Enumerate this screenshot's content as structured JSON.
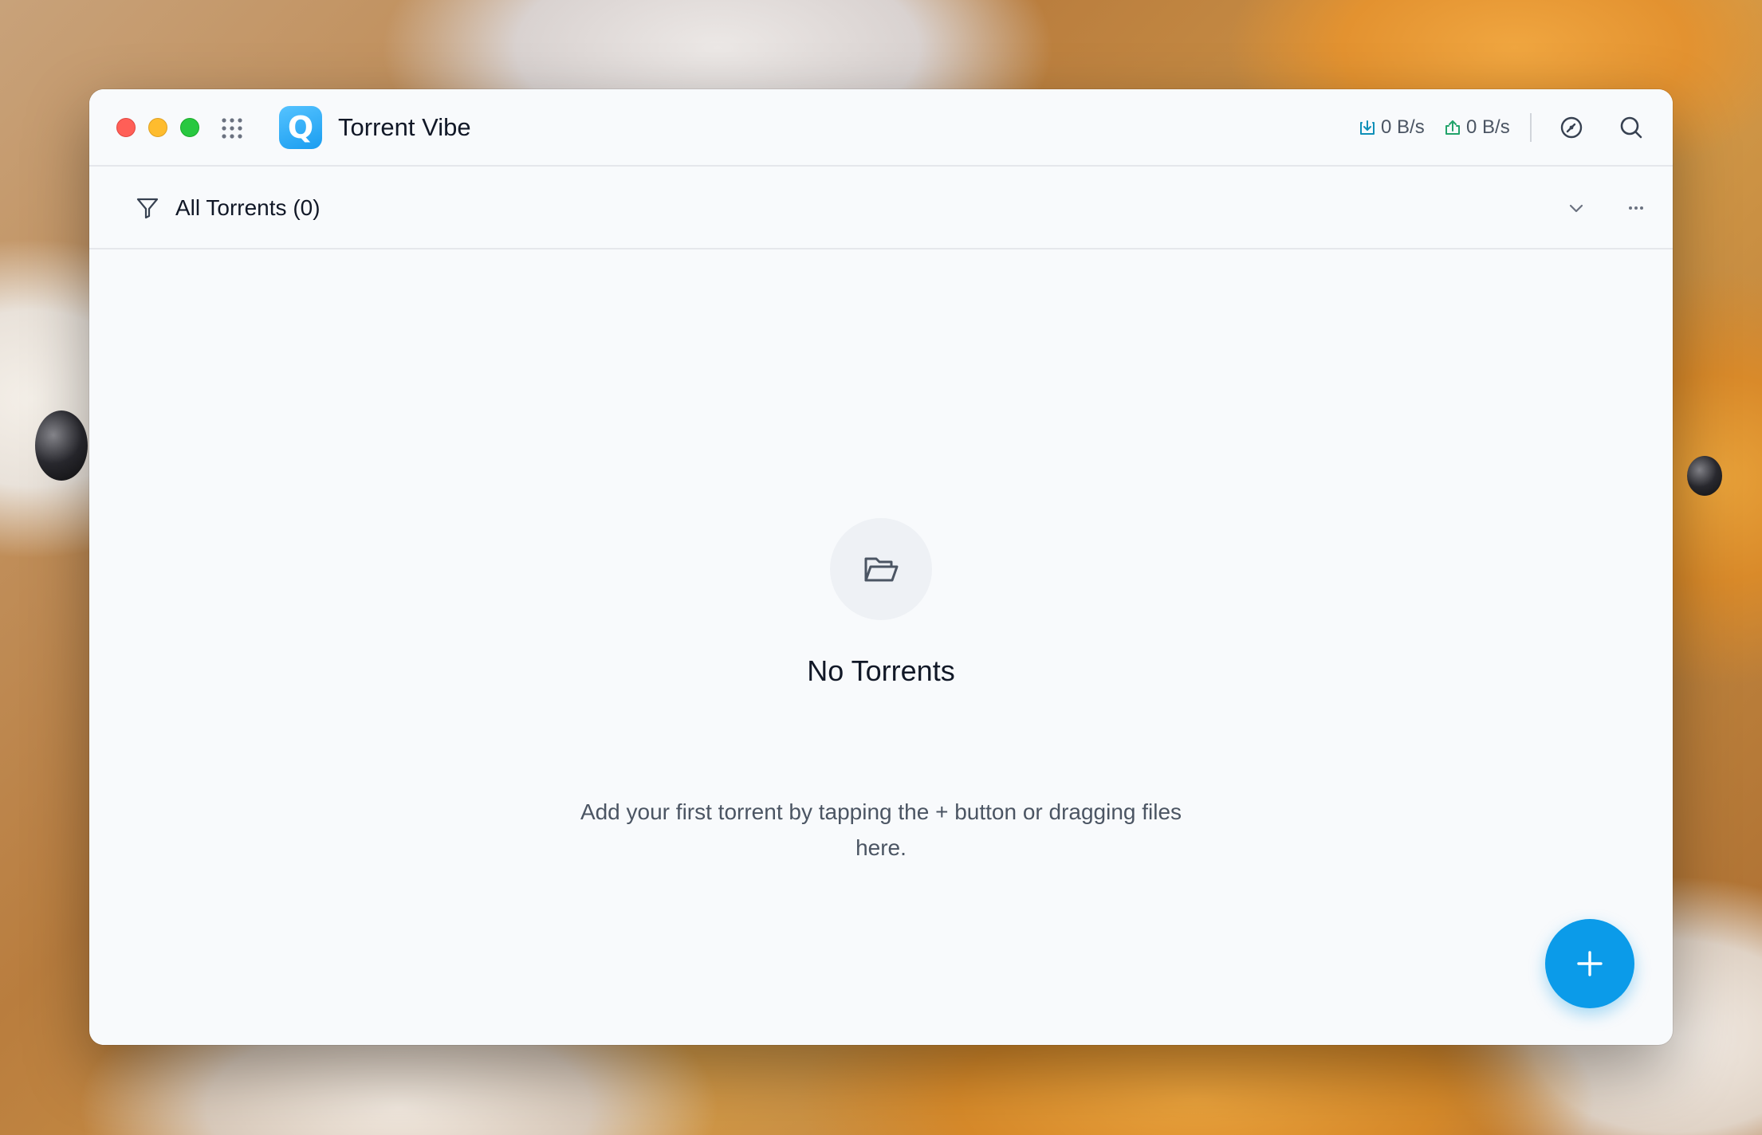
{
  "app": {
    "title": "Torrent Vibe",
    "logo_letter": "Q"
  },
  "toolbar": {
    "download_speed": "0 B/s",
    "upload_speed": "0 B/s",
    "download_icon": "download-icon",
    "upload_icon": "upload-icon",
    "speed_limit_icon": "speed-limit-icon",
    "search_icon": "search-icon"
  },
  "filter": {
    "label": "All Torrents (0)",
    "icon": "filter-icon",
    "chevron_icon": "chevron-down-icon",
    "more_icon": "more-icon"
  },
  "empty_state": {
    "icon": "folder-open-icon",
    "title": "No Torrents",
    "message": "Add your first torrent by tapping the + button or dragging files here."
  },
  "fab": {
    "icon": "plus-icon"
  },
  "colors": {
    "accent": "#0b9be9",
    "download": "#0e8fb8",
    "upload": "#22a36b",
    "traffic_close": "#ff5f57",
    "traffic_minimize": "#febc2e",
    "traffic_zoom": "#28c840"
  }
}
